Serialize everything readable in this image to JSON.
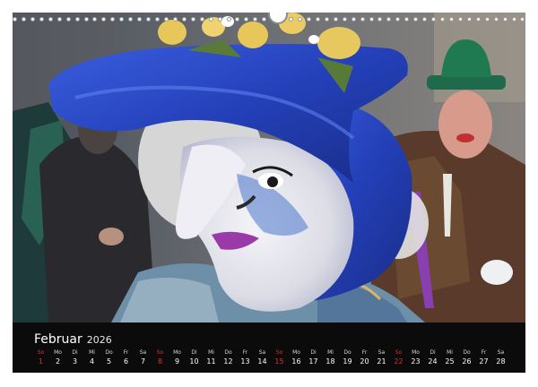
{
  "calendar": {
    "month": "Februar",
    "year": "2026",
    "days": [
      {
        "dow": "So",
        "num": "1",
        "sunday": true
      },
      {
        "dow": "Mo",
        "num": "2"
      },
      {
        "dow": "Di",
        "num": "3"
      },
      {
        "dow": "Mi",
        "num": "4"
      },
      {
        "dow": "Do",
        "num": "5"
      },
      {
        "dow": "Fr",
        "num": "6"
      },
      {
        "dow": "Sa",
        "num": "7"
      },
      {
        "dow": "So",
        "num": "8",
        "sunday": true
      },
      {
        "dow": "Mo",
        "num": "9"
      },
      {
        "dow": "Di",
        "num": "10"
      },
      {
        "dow": "Mi",
        "num": "11"
      },
      {
        "dow": "Do",
        "num": "12"
      },
      {
        "dow": "Fr",
        "num": "13"
      },
      {
        "dow": "Sa",
        "num": "14"
      },
      {
        "dow": "So",
        "num": "15",
        "sunday": true
      },
      {
        "dow": "Mo",
        "num": "16"
      },
      {
        "dow": "Di",
        "num": "17"
      },
      {
        "dow": "Mi",
        "num": "18"
      },
      {
        "dow": "Do",
        "num": "19"
      },
      {
        "dow": "Fr",
        "num": "20"
      },
      {
        "dow": "Sa",
        "num": "21"
      },
      {
        "dow": "So",
        "num": "22",
        "sunday": true
      },
      {
        "dow": "Mo",
        "num": "23"
      },
      {
        "dow": "Di",
        "num": "24"
      },
      {
        "dow": "Mi",
        "num": "25"
      },
      {
        "dow": "Do",
        "num": "26"
      },
      {
        "dow": "Fr",
        "num": "27"
      },
      {
        "dow": "Sa",
        "num": "28"
      }
    ]
  },
  "colors": {
    "sunday": "#e0302a",
    "bar": "#0b0b0b",
    "costume_blue": "#2a49c4"
  }
}
